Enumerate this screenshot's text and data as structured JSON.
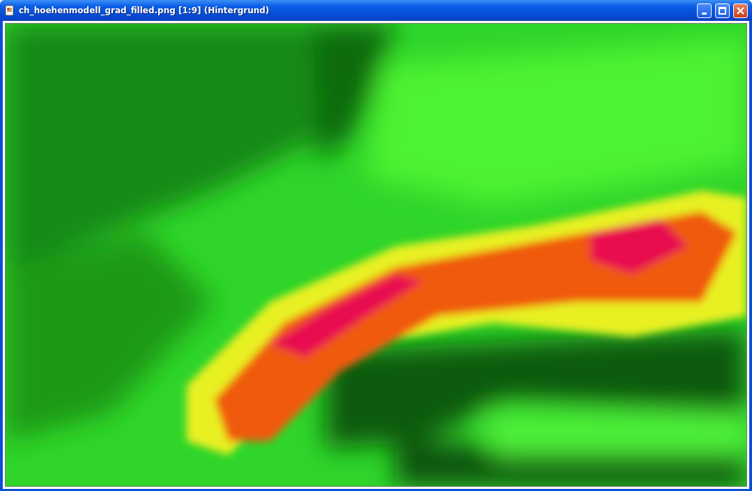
{
  "window": {
    "title": "ch_hoehenmodell_grad_filled.png [1:9] (Hintergrund)"
  },
  "window_controls": [
    {
      "kind": "minimize"
    },
    {
      "kind": "maximize"
    },
    {
      "kind": "close"
    }
  ]
}
